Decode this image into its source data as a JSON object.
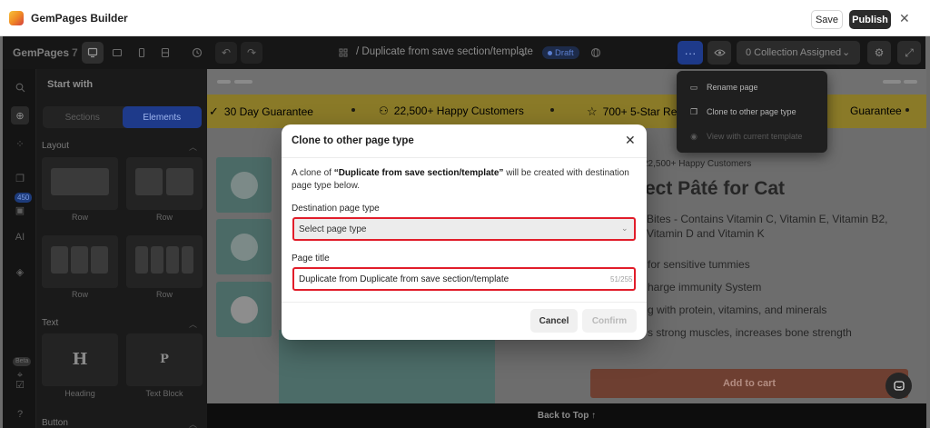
{
  "app": {
    "title": "GemPages Builder",
    "save_label": "Save",
    "publish_label": "Publish"
  },
  "toolbar": {
    "brand": "GemPages",
    "version": "7",
    "page_title": "/ Duplicate from save section/template",
    "status_badge": "Draft",
    "collection_label": "0 Collection Assigned"
  },
  "menu": {
    "items": [
      {
        "label": "Rename page",
        "icon": "rename-icon",
        "enabled": true
      },
      {
        "label": "Clone to other page type",
        "icon": "clone-icon",
        "enabled": true
      },
      {
        "label": "View with current template",
        "icon": "eye-icon",
        "enabled": false
      }
    ]
  },
  "sidebar": {
    "rail_badge": "450",
    "rail_beta": "Beta",
    "panel_title": "Start with",
    "tabs": [
      "Sections",
      "Elements"
    ],
    "active_tab": "Elements",
    "sections": [
      {
        "title": "Layout",
        "items": [
          "Row",
          "Row",
          "Row",
          "Row"
        ]
      },
      {
        "title": "Text",
        "items": [
          "Heading",
          "Text Block"
        ],
        "glyphs": [
          "H",
          "P"
        ]
      },
      {
        "title": "Button"
      }
    ]
  },
  "canvas": {
    "trust": [
      "30 Day Guarantee",
      "22,500+ Happy Customers",
      "700+ 5-Star Rev",
      "Guarantee"
    ],
    "customers_text": "22,500+ Happy Customers",
    "product_title": "ect Pâté for Cat",
    "description": [
      "Bites - Contains Vitamin C, Vitamin E, Vitamin B2,",
      "Vitamin D and Vitamin K"
    ],
    "bullets": [
      "for sensitive tummies",
      "harge immunity System",
      "g with protein, vitamins, and minerals",
      "s strong muscles, increases bone strength"
    ],
    "add_to_cart": "Add to cart",
    "back_to_top": "Back to Top ↑"
  },
  "modal": {
    "title": "Clone to other page type",
    "desc_prefix": "A clone of ",
    "desc_name": "“Duplicate from save section/template”",
    "desc_suffix": " will be created with destination page type below.",
    "dest_label": "Destination page type",
    "dest_placeholder": "Select page type",
    "title_label": "Page title",
    "title_value": "Duplicate from Duplicate from save section/template",
    "char_count": "51/255",
    "cancel_label": "Cancel",
    "confirm_label": "Confirm"
  },
  "colors": {
    "accent": "#1e3a8a",
    "publish": "#2b2b2b",
    "highlight": "#e11d2a",
    "trust_bar": "#f5d84e",
    "add_to_cart": "#d9573b"
  }
}
